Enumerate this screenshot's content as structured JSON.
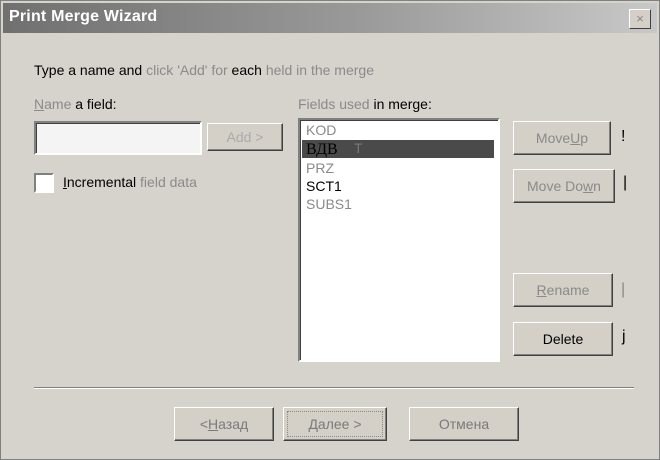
{
  "window": {
    "title": "Print Merge Wizard",
    "close_glyph": "×"
  },
  "instruction": {
    "part1": "Type a name and ",
    "part2": "click 'Add' for",
    "part3": " each ",
    "part4": "held in the merge"
  },
  "name_field": {
    "label_first": "N",
    "label_rest": "ame",
    "label_tail": " a field:",
    "value": ""
  },
  "add_button": {
    "label": "Add >"
  },
  "incremental": {
    "label_first": "I",
    "label_rest": "ncremental",
    "label_tail": " field data"
  },
  "fields_used": {
    "label_first": "Fields used",
    "label_tail": " in merge:",
    "items": [
      "KOD",
      "ВДВ",
      "PRZ",
      "SCT1",
      "SUBS1"
    ],
    "selected_ghost": "T"
  },
  "buttons": {
    "move_up_pre": "Move ",
    "move_up_key": "U",
    "move_up_post": "p",
    "move_down_pre": "Move Do",
    "move_down_key": "w",
    "move_down_post": "n",
    "rename_key": "R",
    "rename_rest": "ename",
    "delete": "Delete"
  },
  "side_marks": {
    "move_up": "!",
    "move_down": "|",
    "rename": "|",
    "delete": "j"
  },
  "footer": {
    "back_pre": "< ",
    "back_key": "Н",
    "back_rest": "азад",
    "next": "Далее >",
    "cancel": "Отмена"
  }
}
